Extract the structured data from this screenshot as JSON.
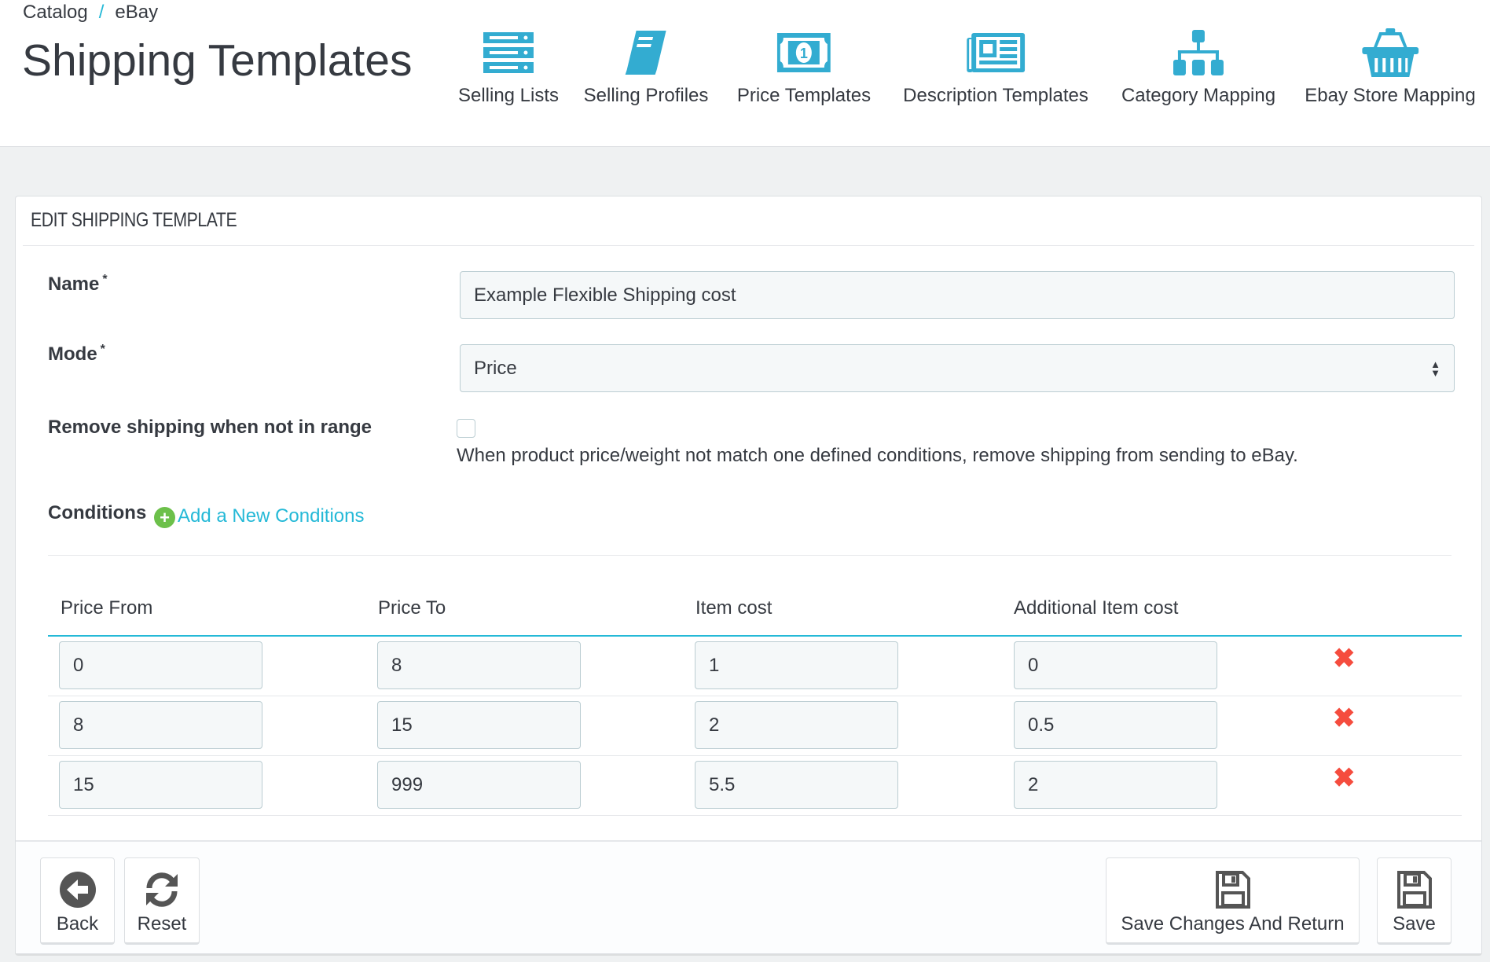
{
  "breadcrumb": [
    "Catalog",
    "eBay"
  ],
  "page_title": "Shipping Templates",
  "accent": "#33acd1",
  "nav": [
    {
      "label": "Selling Lists",
      "icon": "list-icon"
    },
    {
      "label": "Selling Profiles",
      "icon": "book-icon"
    },
    {
      "label": "Price Templates",
      "icon": "money-icon"
    },
    {
      "label": "Description Templates",
      "icon": "newspaper-icon"
    },
    {
      "label": "Category Mapping",
      "icon": "sitemap-icon"
    },
    {
      "label": "Ebay Store Mapping",
      "icon": "basket-icon"
    }
  ],
  "panel": {
    "heading": "EDIT SHIPPING TEMPLATE",
    "name_label": "Name",
    "required": "*",
    "name_value": "Example Flexible Shipping cost",
    "mode_label": "Mode",
    "mode_value": "Price",
    "remove_label": "Remove shipping when not in range",
    "remove_checked": false,
    "remove_help": "When product price/weight not match one defined conditions, remove shipping from sending to eBay.",
    "conditions_label": "Conditions",
    "add_conditions": "Add a New Conditions"
  },
  "table": {
    "headers": [
      "Price From",
      "Price To",
      "Item cost",
      "Additional Item cost"
    ],
    "rows": [
      [
        "0",
        "8",
        "1",
        "0"
      ],
      [
        "8",
        "15",
        "2",
        "0.5"
      ],
      [
        "15",
        "999",
        "5.5",
        "2"
      ]
    ],
    "delete_glyph": "✖"
  },
  "footer": {
    "back": "Back",
    "reset": "Reset",
    "save_return": "Save Changes And Return",
    "save": "Save"
  }
}
